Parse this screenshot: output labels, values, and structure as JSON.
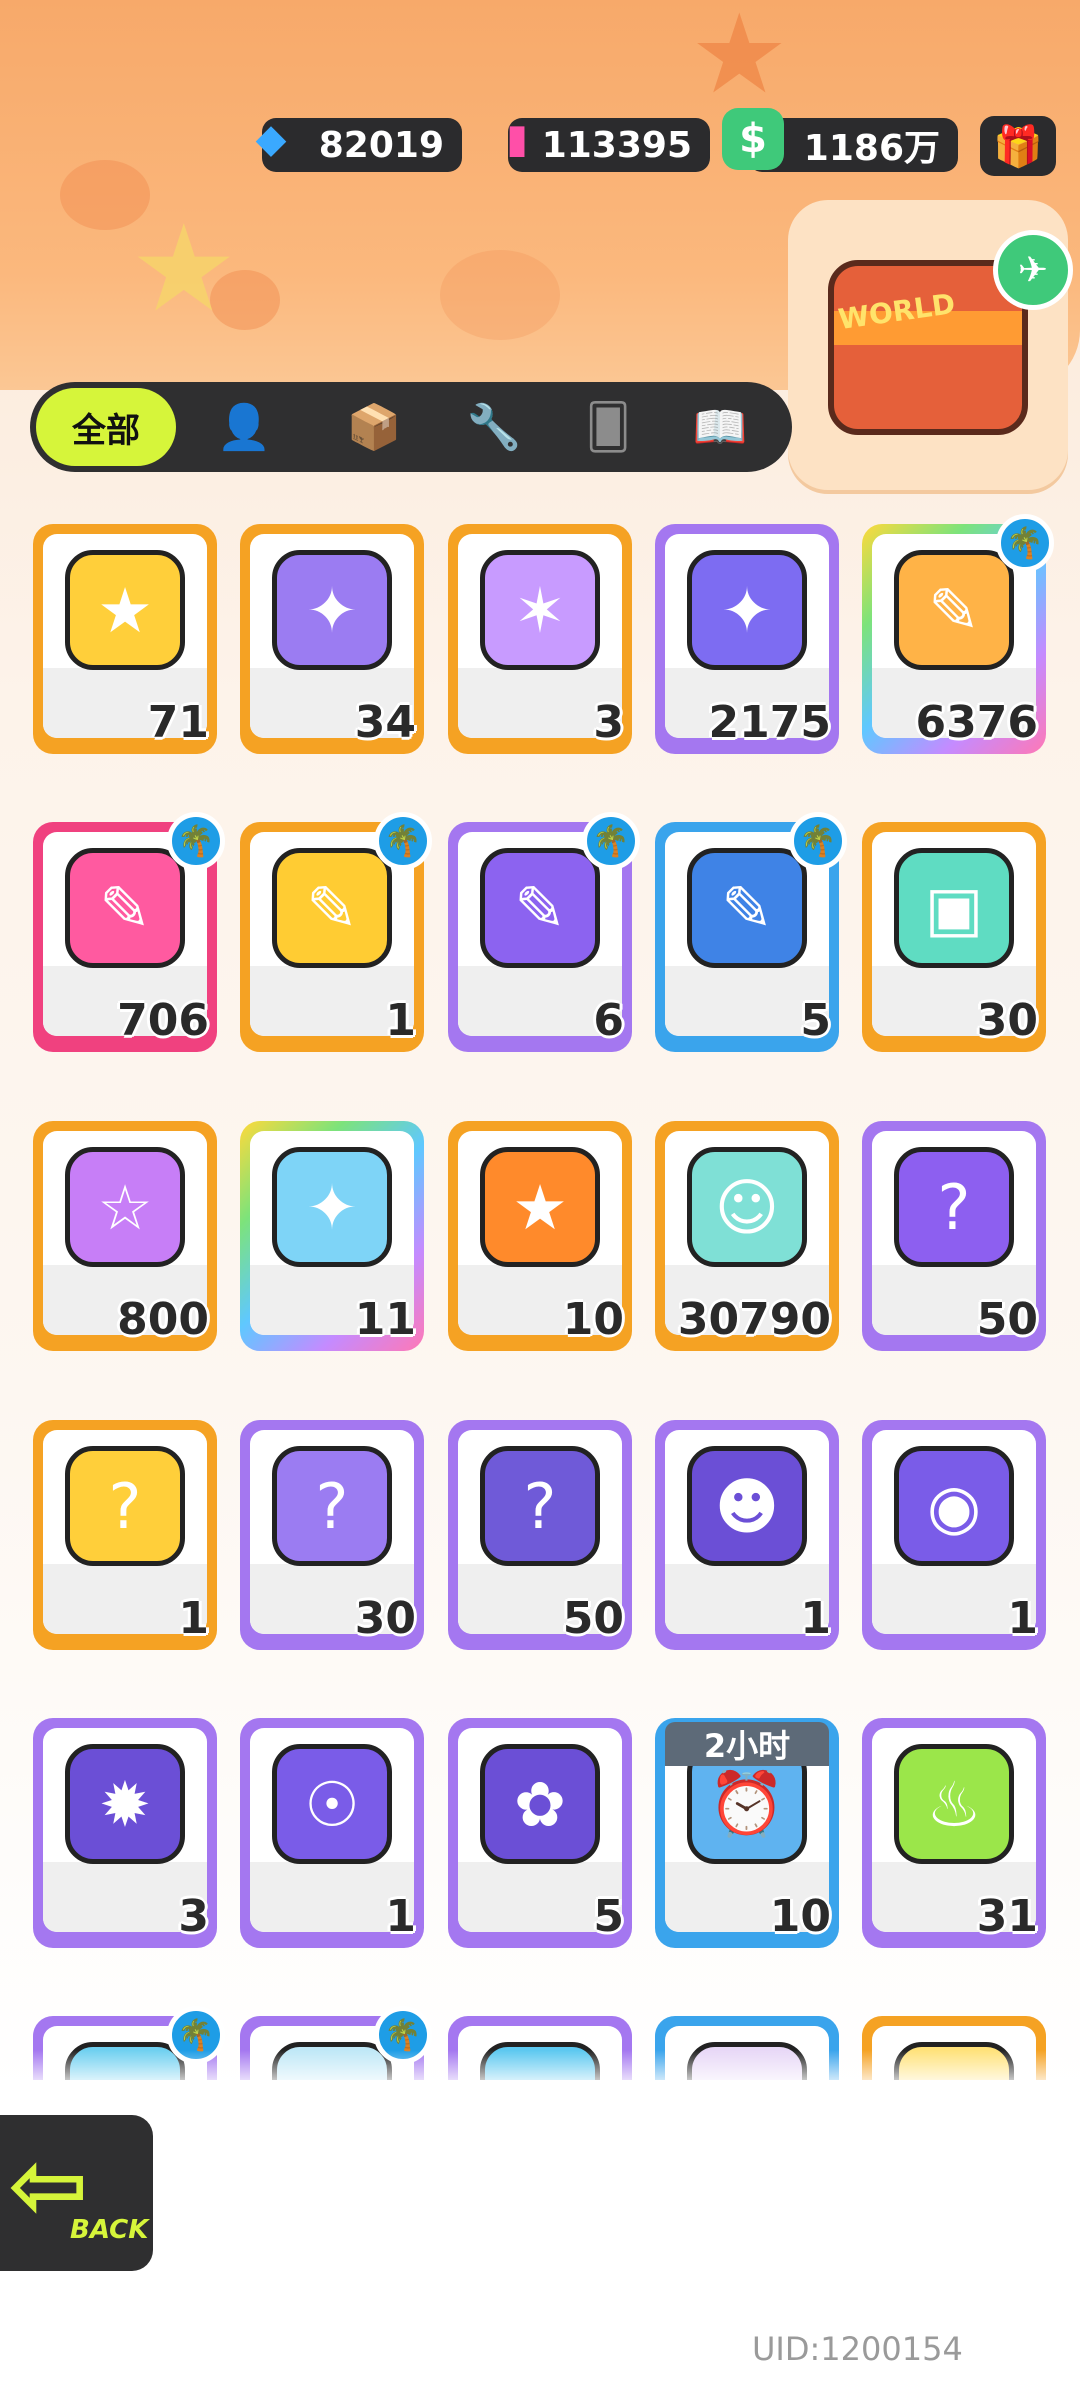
{
  "currencies": [
    {
      "name": "diamond",
      "icon": "diamond-icon",
      "glyph": "◆",
      "value": "82019"
    },
    {
      "name": "spray-can",
      "icon": "spray-can-icon",
      "glyph": "▮",
      "value": "113395"
    },
    {
      "name": "cash",
      "icon": "cash-icon",
      "glyph": "$",
      "value": "1186万"
    }
  ],
  "header": {
    "gift_glyph": "🎁",
    "world_label": "WORLD"
  },
  "tabs": {
    "active_label": "全部",
    "items": [
      {
        "icon": "person-icon",
        "glyph": "👤"
      },
      {
        "icon": "box-icon",
        "glyph": "📦"
      },
      {
        "icon": "tool-icon",
        "glyph": "🔧"
      },
      {
        "icon": "cards-icon",
        "glyph": "🂠"
      },
      {
        "icon": "book-icon",
        "glyph": "📖"
      }
    ]
  },
  "items": [
    {
      "name": "deity-ticket-gold",
      "frame": "#f5a223",
      "art": "#ffcf3a",
      "glyph": "★",
      "count": "71"
    },
    {
      "name": "deity-ticket-purple",
      "frame": "#f5a223",
      "art": "#9b7cf2",
      "glyph": "✦",
      "count": "34"
    },
    {
      "name": "rainbow-star",
      "frame": "#f5a223",
      "art": "#c89bff",
      "glyph": "✶",
      "count": "3"
    },
    {
      "name": "purple-star",
      "frame": "#a477f0",
      "art": "#7d6cf2",
      "glyph": "✦",
      "count": "2175"
    },
    {
      "name": "rainbow-crayon",
      "frame": "rainbow",
      "art": "#ffb347",
      "glyph": "✎",
      "count": "6376",
      "badge": true
    },
    {
      "name": "pink-crayon",
      "frame": "#f0417f",
      "art": "#ff5aa0",
      "glyph": "✎",
      "count": "706",
      "badge": true
    },
    {
      "name": "yellow-crayon",
      "frame": "#f5a223",
      "art": "#ffcc33",
      "glyph": "✎",
      "count": "1",
      "badge": true
    },
    {
      "name": "purple-crayon",
      "frame": "#a477f0",
      "art": "#8c63f0",
      "glyph": "✎",
      "count": "6",
      "badge": true
    },
    {
      "name": "blue-crayon",
      "frame": "#3aa4ec",
      "art": "#3f83e6",
      "glyph": "✎",
      "count": "5",
      "badge": true
    },
    {
      "name": "color-cube",
      "frame": "#f5a223",
      "art": "#5fdcc2",
      "glyph": "▣",
      "count": "30"
    },
    {
      "name": "cool-badge",
      "frame": "#f5a223",
      "art": "#c77ef7",
      "glyph": "☆",
      "count": "800"
    },
    {
      "name": "lottery-ticket",
      "frame": "rainbow",
      "art": "#7ed4f7",
      "glyph": "✦",
      "count": "11"
    },
    {
      "name": "star-medal",
      "frame": "#f5a223",
      "art": "#ff8a2b",
      "glyph": "★",
      "count": "10"
    },
    {
      "name": "season-ticket",
      "frame": "#f5a223",
      "art": "#7fe0d6",
      "glyph": "☺",
      "count": "30790"
    },
    {
      "name": "mystery-egg",
      "frame": "#a477f0",
      "art": "#8d5ff0",
      "glyph": "?",
      "count": "50"
    },
    {
      "name": "deity-mystery-gold",
      "frame": "#f5a223",
      "art": "#ffcf3a",
      "glyph": "?",
      "count": "1"
    },
    {
      "name": "deity-mystery-purple",
      "frame": "#a477f0",
      "art": "#9b7cf2",
      "glyph": "?",
      "count": "30"
    },
    {
      "name": "travel-card-mystery",
      "frame": "#a477f0",
      "art": "#6f5ad8",
      "glyph": "?",
      "count": "50"
    },
    {
      "name": "mpety-bat-ball",
      "frame": "#a477f0",
      "art": "#6b4fd6",
      "glyph": "☻",
      "count": "1"
    },
    {
      "name": "mpety-fish-ball",
      "frame": "#a477f0",
      "art": "#7a5ce8",
      "glyph": "◉",
      "count": "1"
    },
    {
      "name": "mpety-piranha-ball",
      "frame": "#a477f0",
      "art": "#6b4fd6",
      "glyph": "✹",
      "count": "3"
    },
    {
      "name": "mpety-jelly-ball",
      "frame": "#a477f0",
      "art": "#7a5ce8",
      "glyph": "☉",
      "count": "1"
    },
    {
      "name": "mpety-plant-ball",
      "frame": "#a477f0",
      "art": "#6b4fd6",
      "glyph": "✿",
      "count": "5"
    },
    {
      "name": "alarm-clock",
      "frame": "#3aa4ec",
      "art": "#5fb3f0",
      "glyph": "⏰",
      "count": "10",
      "timer": "2小时"
    },
    {
      "name": "green-cup",
      "frame": "#a477f0",
      "art": "#9be64a",
      "glyph": "♨",
      "count": "31"
    },
    {
      "name": "partial-item-1",
      "frame": "#a477f0",
      "art": "#6fd0f0",
      "glyph": "☁",
      "count": "",
      "badge": true
    },
    {
      "name": "partial-item-2",
      "frame": "#a477f0",
      "art": "#bfe8f7",
      "glyph": "✎",
      "count": "",
      "badge": true
    },
    {
      "name": "partial-item-3",
      "frame": "#a477f0",
      "art": "#5cc8f0",
      "glyph": "☁",
      "count": ""
    },
    {
      "name": "partial-item-4",
      "frame": "#3aa4ec",
      "art": "#e8d8f7",
      "glyph": "✦",
      "count": ""
    },
    {
      "name": "partial-item-5",
      "frame": "#f5a223",
      "art": "#ffe27a",
      "glyph": "◆",
      "count": ""
    }
  ],
  "back": {
    "label": "BACK",
    "glyph": "⇦"
  },
  "uid": "UID:1200154"
}
